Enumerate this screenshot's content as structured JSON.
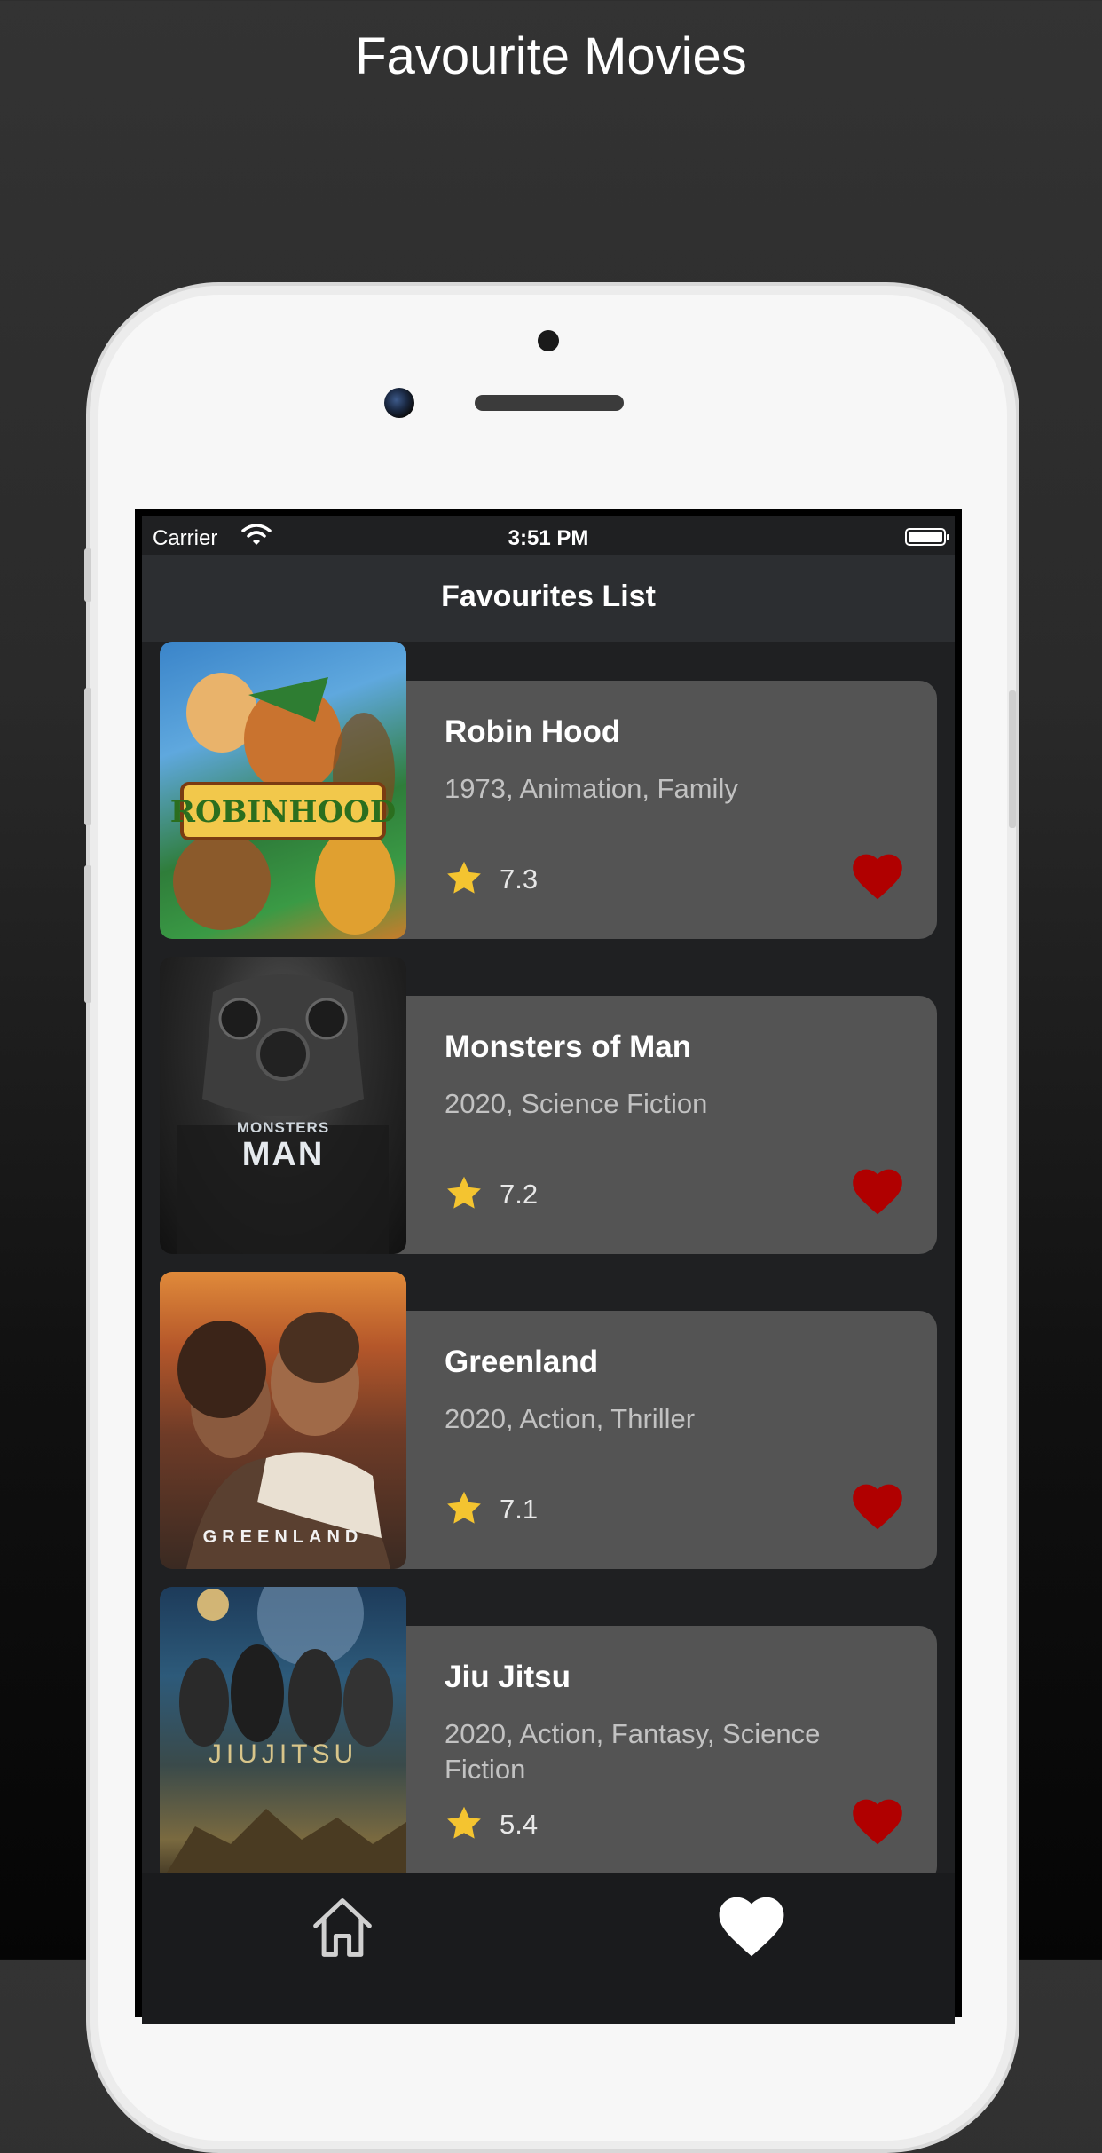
{
  "promo": {
    "title": "Favourite Movies"
  },
  "status_bar": {
    "carrier": "Carrier",
    "time": "3:51 PM"
  },
  "nav": {
    "title": "Favourites List"
  },
  "movies": [
    {
      "title": "Robin Hood",
      "meta": "1973, Animation, Family",
      "rating": "7.3",
      "poster_text": "ROBINHOOD"
    },
    {
      "title": "Monsters of Man",
      "meta": "2020, Science Fiction",
      "rating": "7.2",
      "poster_text_small": "MONSTERS",
      "poster_text": "MAN"
    },
    {
      "title": "Greenland",
      "meta": "2020, Action, Thriller",
      "rating": "7.1",
      "poster_text": "GREENLAND"
    },
    {
      "title": "Jiu Jitsu",
      "meta": "2020, Action, Fantasy, Science Fiction",
      "rating": "5.4",
      "poster_text": "JIUJITSU"
    }
  ],
  "colors": {
    "heart": "#b00000",
    "star": "#f4c430",
    "card": "#545454",
    "background": "#1f2022"
  },
  "tabs": [
    {
      "name": "home",
      "icon": "home-icon"
    },
    {
      "name": "favourites",
      "icon": "heart-icon"
    }
  ]
}
